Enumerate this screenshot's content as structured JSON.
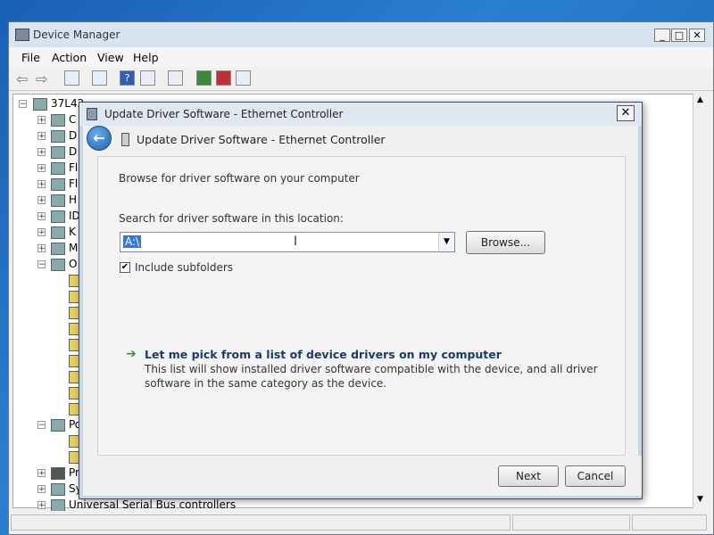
{
  "device_manager": {
    "title": "Device Manager",
    "menu": [
      "File",
      "Action",
      "View",
      "Help"
    ],
    "tree": {
      "root": "37L42",
      "items": [
        "C",
        "D",
        "D",
        "Fl",
        "Fl",
        "H",
        "ID",
        "K",
        "M",
        "O",
        "Po",
        "Pr",
        "Sy",
        "Universal Serial Bus controllers"
      ]
    }
  },
  "dialog": {
    "title": "Update Driver Software - Ethernet Controller",
    "nav_title": "Update Driver Software - Ethernet Controller",
    "heading": "Browse for driver software on your computer",
    "search_label": "Search for driver software in this location:",
    "path_value": "A:\\",
    "browse_label": "Browse...",
    "include_subfolders_label": "Include subfolders",
    "pick_link_title": "Let me pick from a list of device drivers on my computer",
    "pick_desc_line1": "This list will show installed driver software compatible with the device, and all driver",
    "pick_desc_line2": "software in the same category as the device.",
    "next_label": "Next",
    "cancel_label": "Cancel"
  },
  "colors": {
    "accent": "#3a78d6",
    "link": "#1a3a6a",
    "arrow": "#2a9a2a"
  }
}
